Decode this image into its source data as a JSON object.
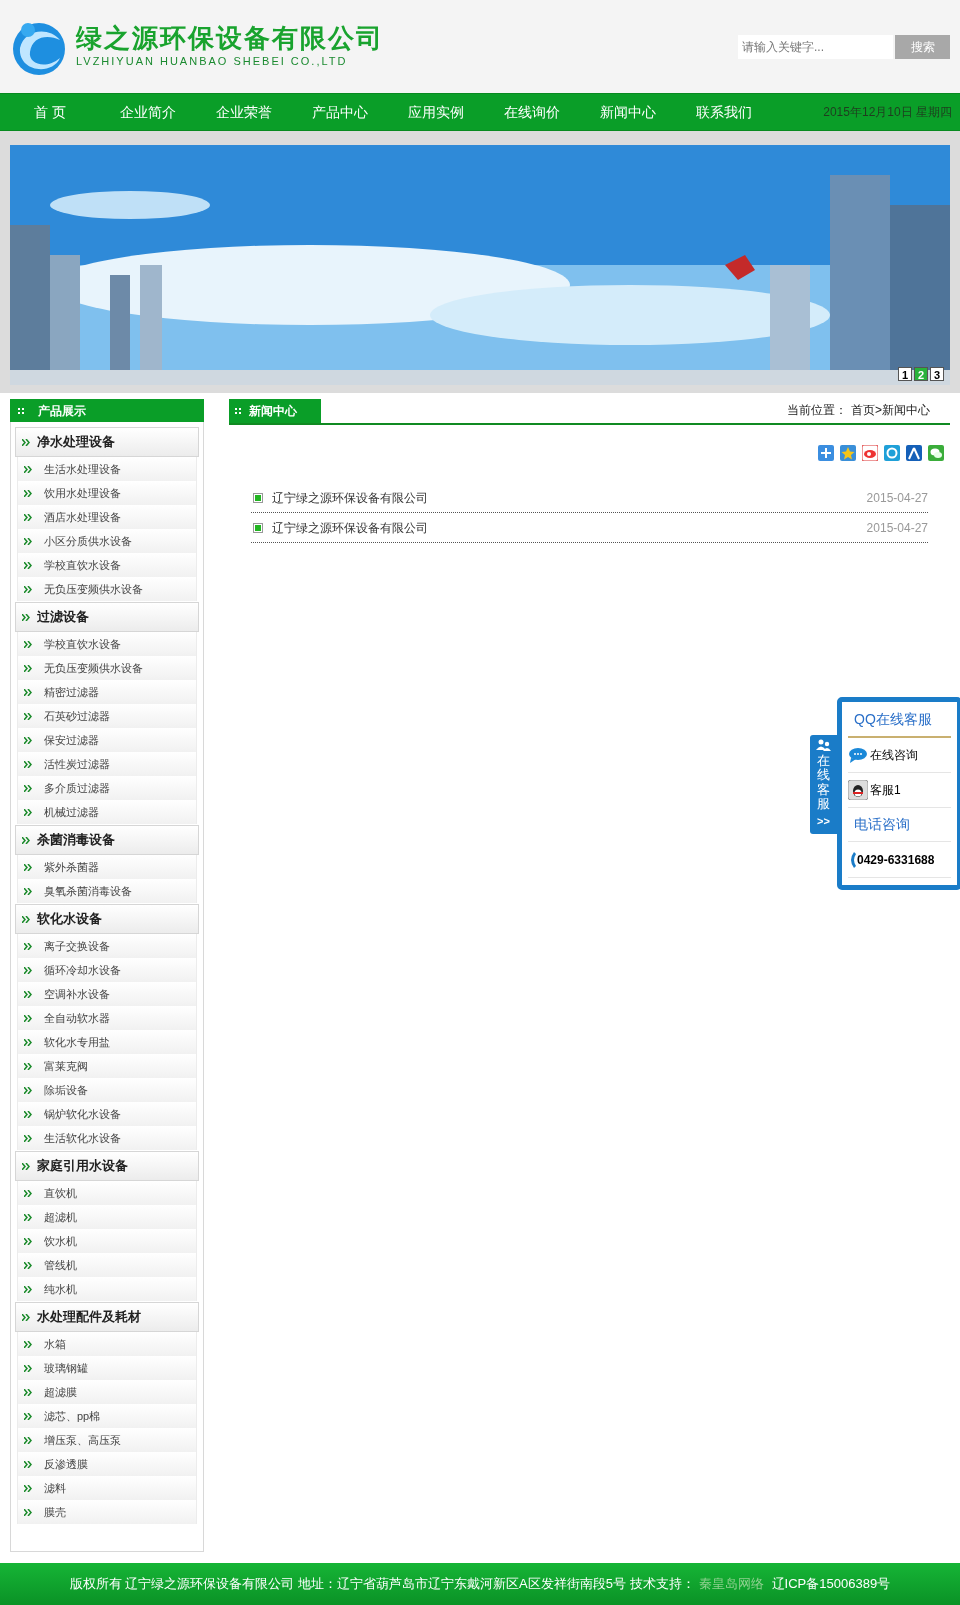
{
  "header": {
    "logo_name": "绿之源环保设备有限公司",
    "logo_subtitle": "LVZHIYUAN HUANBAO SHEBEI CO.,LTD",
    "search": {
      "placeholder": "请输入关键字...",
      "button": "搜索"
    }
  },
  "nav": {
    "items": [
      {
        "label": "首 页"
      },
      {
        "label": "企业简介"
      },
      {
        "label": "企业荣誉"
      },
      {
        "label": "产品中心"
      },
      {
        "label": "应用实例"
      },
      {
        "label": "在线询价"
      },
      {
        "label": "新闻中心"
      },
      {
        "label": "联系我们"
      }
    ],
    "date": "2015年12月10日 星期四"
  },
  "banner": {
    "slides": [
      {
        "label": "1",
        "selected": false
      },
      {
        "label": "2",
        "selected": true
      },
      {
        "label": "3",
        "selected": false
      }
    ]
  },
  "sidebar": {
    "title": "产品展示",
    "categories": [
      {
        "label": "净水处理设备",
        "children": [
          {
            "label": "生活水处理设备"
          },
          {
            "label": "饮用水处理设备"
          },
          {
            "label": "酒店水处理设备"
          },
          {
            "label": "小区分质供水设备"
          },
          {
            "label": "学校直饮水设备"
          },
          {
            "label": "无负压变频供水设备"
          }
        ]
      },
      {
        "label": "过滤设备",
        "children": [
          {
            "label": "学校直饮水设备"
          },
          {
            "label": "无负压变频供水设备"
          },
          {
            "label": "精密过滤器"
          },
          {
            "label": "石英砂过滤器"
          },
          {
            "label": "保安过滤器"
          },
          {
            "label": "活性炭过滤器"
          },
          {
            "label": "多介质过滤器"
          },
          {
            "label": "机械过滤器"
          }
        ]
      },
      {
        "label": "杀菌消毒设备",
        "children": [
          {
            "label": "紫外杀菌器"
          },
          {
            "label": "臭氧杀菌消毒设备"
          }
        ]
      },
      {
        "label": "软化水设备",
        "children": [
          {
            "label": "离子交换设备"
          },
          {
            "label": "循环冷却水设备"
          },
          {
            "label": "空调补水设备"
          },
          {
            "label": "全自动软水器"
          },
          {
            "label": "软化水专用盐"
          },
          {
            "label": "富莱克阀"
          },
          {
            "label": "除垢设备"
          },
          {
            "label": "锅炉软化水设备"
          },
          {
            "label": "生活软化水设备"
          }
        ]
      },
      {
        "label": "家庭引用水设备",
        "children": [
          {
            "label": "直饮机"
          },
          {
            "label": "超滤机"
          },
          {
            "label": "饮水机"
          },
          {
            "label": "管线机"
          },
          {
            "label": "纯水机"
          }
        ]
      },
      {
        "label": "水处理配件及耗材",
        "children": [
          {
            "label": "水箱"
          },
          {
            "label": "玻璃钢罐"
          },
          {
            "label": "超滤膜"
          },
          {
            "label": "滤芯、pp棉"
          },
          {
            "label": "增压泵、高压泵"
          },
          {
            "label": "反渗透膜"
          },
          {
            "label": "滤料"
          },
          {
            "label": "膜壳"
          }
        ]
      }
    ]
  },
  "news": {
    "title": "新闻中心",
    "breadcrumb_label": "当前位置：",
    "breadcrumb": "首页>新闻中心",
    "items": [
      {
        "title": "辽宁绿之源环保设备有限公司",
        "date": "2015-04-27"
      },
      {
        "title": "辽宁绿之源环保设备有限公司",
        "date": "2015-04-27"
      }
    ]
  },
  "service": {
    "tab_label": "在线客服",
    "tab_arrow": ">>",
    "title": "QQ在线客服",
    "items": [
      {
        "kind": "chat",
        "label": "在线咨询"
      },
      {
        "kind": "qq",
        "label": "客服1"
      }
    ],
    "phone_title": "电话咨询",
    "phone": "0429-6331688"
  },
  "footer": {
    "text": "版权所有 辽宁绿之源环保设备有限公司 地址：辽宁省葫芦岛市辽宁东戴河新区A区发祥街南段5号 技术支持：",
    "link": "秦皇岛网络",
    "icp": "辽ICP备15006389号"
  }
}
